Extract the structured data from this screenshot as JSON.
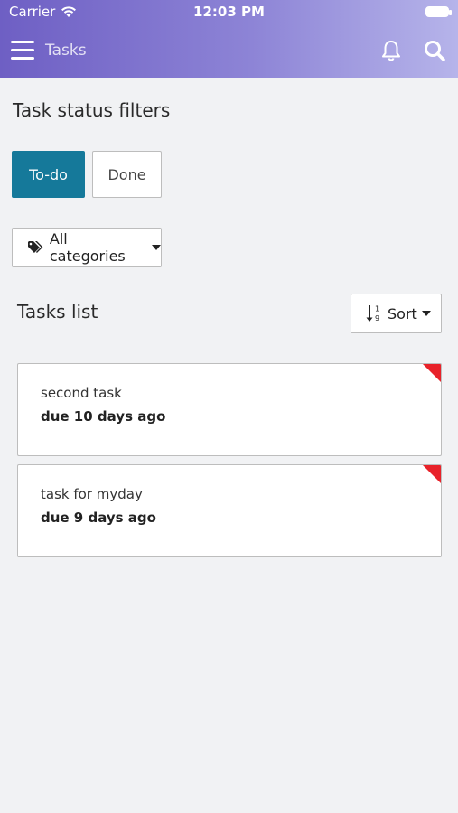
{
  "status_bar": {
    "carrier": "Carrier",
    "time": "12:03 PM"
  },
  "nav": {
    "title": "Tasks",
    "icons": [
      "menu-icon",
      "bell-icon",
      "search-icon"
    ]
  },
  "filters": {
    "title": "Task status filters",
    "todo_label": "To-do",
    "done_label": "Done",
    "categories_label": "All categories"
  },
  "tasks": {
    "title": "Tasks list",
    "sort_label": "Sort",
    "items": [
      {
        "name": "second task",
        "due": "due 10 days ago"
      },
      {
        "name": "task for myday",
        "due": "due 9 days ago"
      }
    ]
  },
  "colors": {
    "header_start": "#6e5fc4",
    "header_end": "#b6b4ea",
    "accent": "#15799a",
    "overdue": "#e8222a",
    "background": "#f1f2f4"
  }
}
